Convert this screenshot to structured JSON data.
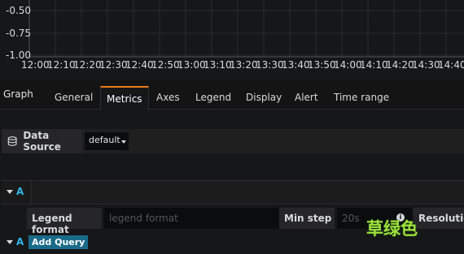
{
  "graph": {
    "y_ticks": [
      "-0.50",
      "-0.75",
      "-1.00"
    ],
    "x_ticks": [
      "12:00",
      "12:10",
      "12:20",
      "12:30",
      "12:40",
      "12:50",
      "13:00",
      "13:10",
      "13:20",
      "13:30",
      "13:40",
      "13:50",
      "14:00",
      "14:10",
      "14:20",
      "14:30",
      "14:40"
    ]
  },
  "panel": {
    "title": "Graph",
    "tabs": [
      {
        "label": "General"
      },
      {
        "label": "Metrics"
      },
      {
        "label": "Axes"
      },
      {
        "label": "Legend"
      },
      {
        "label": "Display"
      },
      {
        "label": "Alert"
      },
      {
        "label": "Time range"
      }
    ],
    "active_tab": "Metrics"
  },
  "datasource": {
    "label": "Data Source",
    "value": "default",
    "icon": "database-icon"
  },
  "query": {
    "letter": "A",
    "legend_format_label": "Legend format",
    "legend_format_placeholder": "legend format",
    "min_step_label": "Min step",
    "min_step_placeholder": "20s",
    "resolution_label": "Resolution"
  },
  "add_query": {
    "letter": "A",
    "label": "Add Query"
  },
  "watermark": "草绿色",
  "colors": {
    "accent_tab": "#eb7b18",
    "query_letter": "#33b5e5",
    "add_button": "#1a6b8a"
  }
}
